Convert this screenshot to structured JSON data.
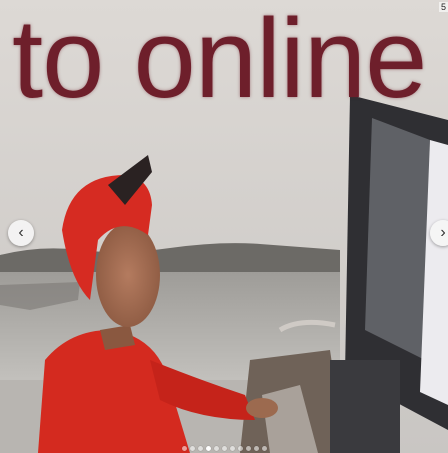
{
  "caption": "to online",
  "corner_text": "5",
  "carousel": {
    "prev_icon": "chevron-left-icon",
    "next_icon": "chevron-right-icon",
    "prev_glyph": "‹",
    "next_glyph": "›",
    "dot_count": 11,
    "active_dot": 3
  },
  "colors": {
    "caption": "#6e1f2b",
    "shirt": "#d42a1f"
  }
}
